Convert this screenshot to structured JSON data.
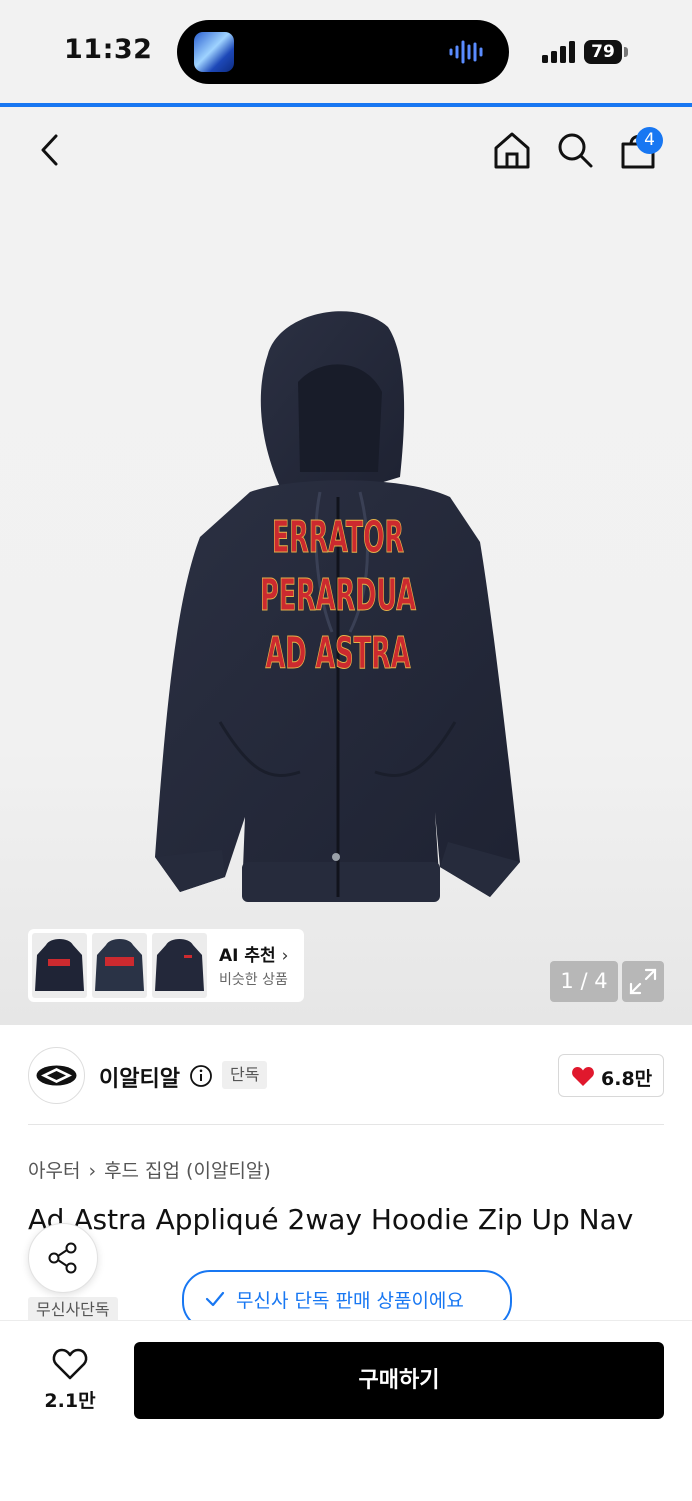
{
  "status_bar": {
    "time": "11:32",
    "battery": "79"
  },
  "nav": {
    "cart_count": "4"
  },
  "gallery": {
    "counter": "1 / 4",
    "ai_title": "AI 추천",
    "ai_subtitle": "비슷한 상품",
    "print_lines": [
      "ERRATOR",
      "PERARDUA",
      "AD ASTRA"
    ]
  },
  "brand": {
    "name": "이알티알",
    "tag": "단독",
    "likes": "6.8만"
  },
  "product": {
    "breadcrumb": [
      "아우터",
      "후드 집업 (이알티알)"
    ],
    "title": "Ad Astra Appliqué 2way Hoodie Zip Up Nav",
    "tag": "무신사단독",
    "exclusive_notice": "무신사 단독 판매 상품이에요"
  },
  "bottom_bar": {
    "wish_count": "2.1만",
    "buy_label": "구매하기"
  },
  "colors": {
    "accent": "#1877f2",
    "heart": "#e0182d",
    "print": "#cc2a2f",
    "hoodie": "#23283a"
  }
}
